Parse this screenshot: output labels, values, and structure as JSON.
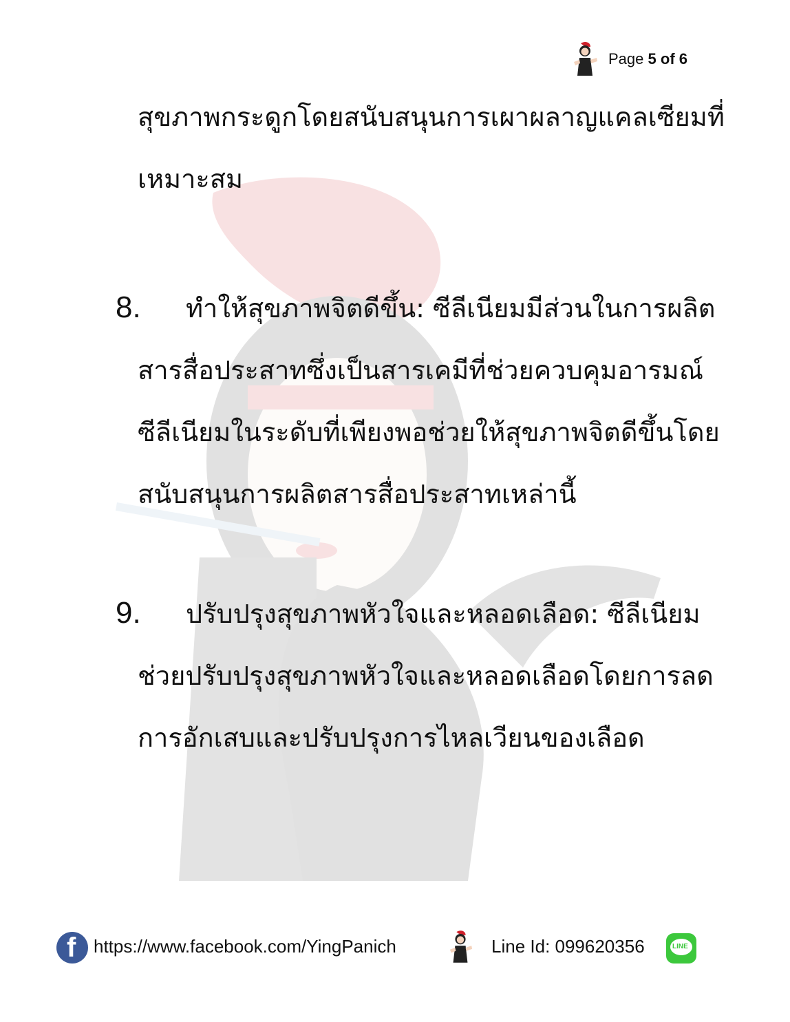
{
  "header": {
    "page_prefix": "Page",
    "page_current": "5",
    "page_of": "of",
    "page_total": "6",
    "mascot_icon": "lady-mascot-icon"
  },
  "paragraph_intro": {
    "lines": [
      "สุขภาพกระดูกโดยสนับสนุนการเผาผลาญแคลเซียมที่",
      "เหมาะสม"
    ]
  },
  "item8": {
    "number": "8.",
    "lines": [
      "ทำให้สุขภาพจิตดีขึ้น: ซีลีเนียมมีส่วนในการผลิต",
      "สารสื่อประสาทซึ่งเป็นสารเคมีที่ช่วยควบคุมอารมณ์",
      "ซีลีเนียมในระดับที่เพียงพอช่วยให้สุขภาพจิตดีขึ้นโดย",
      "สนับสนุนการผลิตสารสื่อประสาทเหล่านี้"
    ]
  },
  "item9": {
    "number": "9.",
    "lines": [
      "ปรับปรุงสุขภาพหัวใจและหลอดเลือด: ซีลีเนียม",
      "ช่วยปรับปรุงสุขภาพหัวใจและหลอดเลือดโดยการลด",
      "การอักเสบและปรับปรุงการไหลเวียนของเลือด"
    ]
  },
  "footer": {
    "facebook_icon": "facebook-icon",
    "facebook_url": "https://www.facebook.com/YingPanich",
    "line_label": "Line Id: 099620356",
    "line_icon_text": "LINE",
    "line_icon": "line-app-icon"
  },
  "colors": {
    "facebook_blue": "#3b5998",
    "line_green": "#3cc83c",
    "watermark_red": "#d0202a",
    "text": "#111111"
  }
}
